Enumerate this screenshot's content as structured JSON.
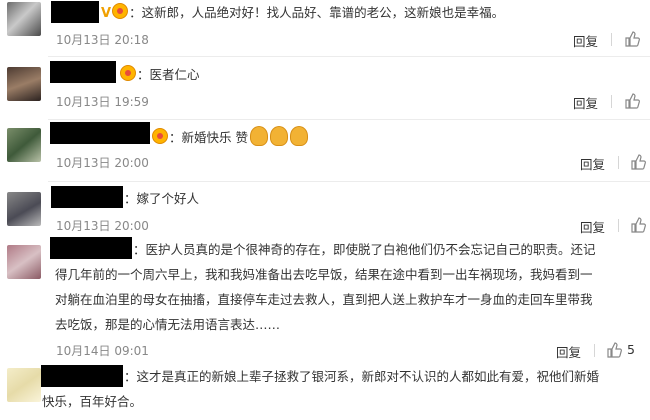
{
  "comments": [
    {
      "text": "：这新郎，人品绝对好！找人品好、靠谱的老公，这新娘也是幸福。",
      "badge_v": "V",
      "date": "10月13日 20:18",
      "reply": "回复",
      "likes": ""
    },
    {
      "text": "：医者仁心",
      "date": "10月13日 19:59",
      "reply": "回复",
      "likes": ""
    },
    {
      "text": "：新婚快乐 赞",
      "date": "10月13日 20:00",
      "reply": "回复",
      "likes": ""
    },
    {
      "text": "：嫁了个好人",
      "date": "10月13日 20:00",
      "reply": "回复",
      "likes": ""
    },
    {
      "lines": [
        "：医护人员真的是个很神奇的存在，即使脱了白袍他们仍不会忘记自己的职责。还记",
        "得几年前的一个周六早上，我和我妈准备出去吃早饭，结果在途中看到一出车祸现场，我妈看到一",
        "对躺在血泊里的母女在抽搐，直接停车走过去救人，直到把人送上救护车才一身血的走回车里带我",
        "去吃饭，那是的心情无法用语言表达……"
      ],
      "date": "10月14日 09:01",
      "reply": "回复",
      "likes": "5"
    },
    {
      "lines": [
        "：这才是真正的新娘上辈子拯救了银河系，新郎对不认识的人都如此有爱，祝他们新婚",
        "快乐，百年好合。"
      ]
    }
  ]
}
